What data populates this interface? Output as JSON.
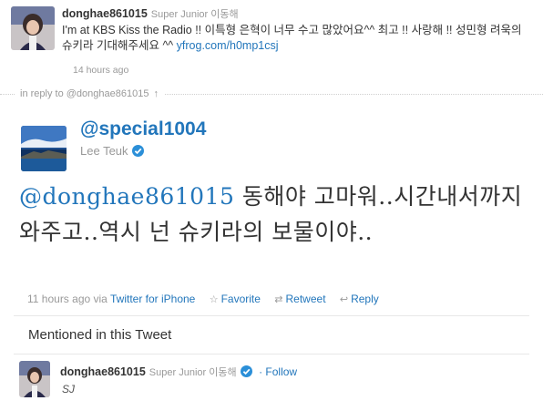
{
  "top_tweet": {
    "screen_name": "donghae861015",
    "real_name": "Super Junior 이동해",
    "text": "I'm at KBS Kiss the Radio !! 이특형 은혁이 너무 수고 많았어요^^ 최고 !! 사랑해 !! 성민형 려욱의 슈키라 기대해주세요 ^^ ",
    "link": "yfrog.com/h0mp1csj",
    "time": "14 hours ago"
  },
  "reply_context": {
    "label": "in reply to @donghae861015",
    "arrow": "↑"
  },
  "main_tweet": {
    "screen_name": "@special1004",
    "real_name": "Lee Teuk",
    "mention": "@donghae861015",
    "text": " 동해야 고마워..시간내서까지 와주고..역시 넌 슈키라의 보물이야..",
    "time": "11 hours ago",
    "via_label": "via",
    "source": "Twitter for iPhone",
    "actions": {
      "favorite": "Favorite",
      "retweet": "Retweet",
      "reply": "Reply"
    }
  },
  "mentioned": {
    "heading": "Mentioned in this Tweet",
    "screen_name": "donghae861015",
    "real_name": "Super Junior 이동해",
    "follow_label": "Follow",
    "bio": "SJ"
  },
  "colors": {
    "link": "#2276bb",
    "verified": "#2b8fd8"
  }
}
